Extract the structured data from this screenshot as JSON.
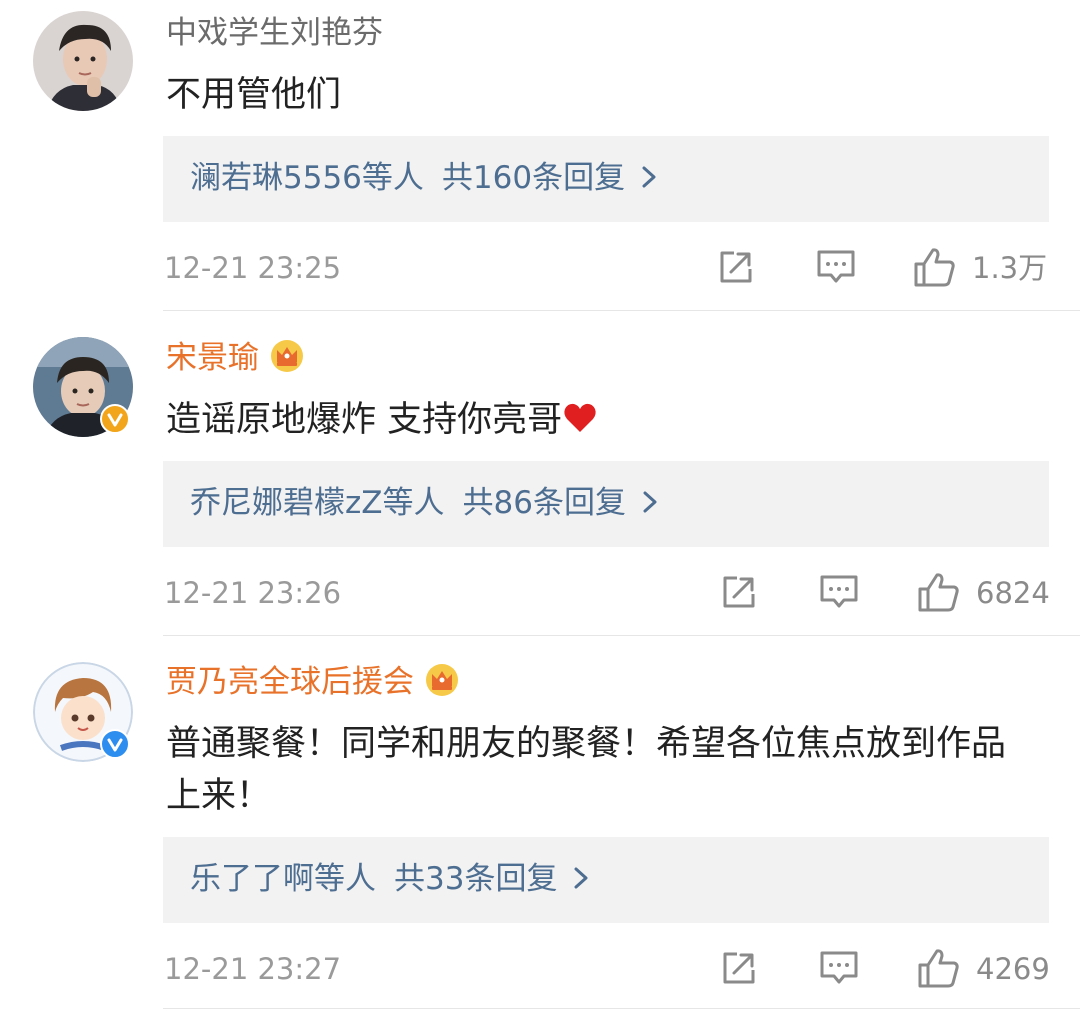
{
  "comments": [
    {
      "username": "中戏学生刘艳芬",
      "text": "不用管他们",
      "reply_names": "澜若琳5556等人",
      "reply_count": "共160条回复",
      "time": "12-21 23:25",
      "likes": "1.3万"
    },
    {
      "username": "宋景瑜",
      "text": "造谣原地爆炸 支持你亮哥",
      "reply_names": "乔尼娜碧檬zZ等人",
      "reply_count": "共86条回复",
      "time": "12-21 23:26",
      "likes": "6824"
    },
    {
      "username": "贾乃亮全球后援会",
      "text": "普通聚餐！同学和朋友的聚餐！希望各位焦点放到作品上来！",
      "reply_names": "乐了了啊等人",
      "reply_count": "共33条回复",
      "time": "12-21 23:27",
      "likes": "4269"
    }
  ],
  "colors": {
    "vip_name": "#e8722a",
    "reply_link": "#4e6e91",
    "verified": "#f2a51a",
    "verified_blue": "#2d8ef0"
  },
  "icons": {
    "share": "share-icon",
    "comment": "comment-icon",
    "like": "thumbs-up-icon",
    "crown": "crown-icon",
    "heart": "heart-icon",
    "chevron": "chevron-right-icon"
  }
}
